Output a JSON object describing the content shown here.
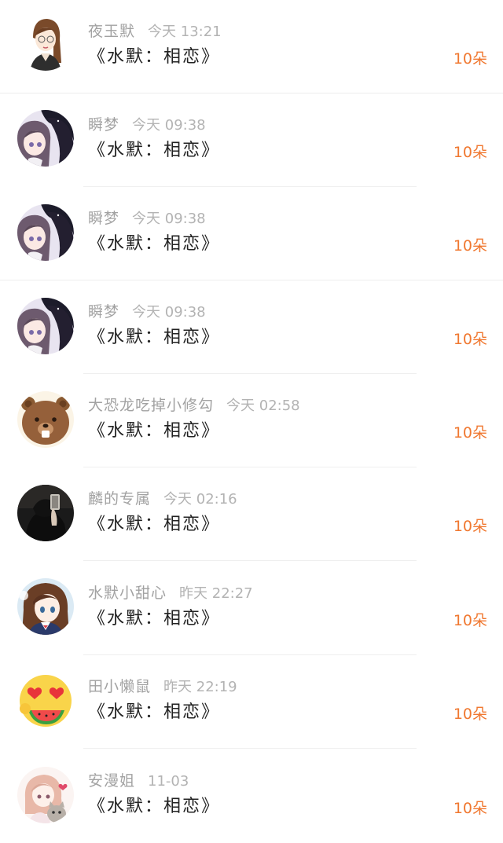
{
  "rows": [
    {
      "name": "夜玉默",
      "time": "今天 13:21",
      "book": "《水默：相恋》",
      "count": "10朵",
      "avatar": "girl-sketch"
    },
    {
      "name": "瞬梦",
      "time": "今天 09:38",
      "book": "《水默：相恋》",
      "count": "10朵",
      "avatar": "anime-couple"
    },
    {
      "name": "瞬梦",
      "time": "今天 09:38",
      "book": "《水默：相恋》",
      "count": "10朵",
      "avatar": "anime-couple"
    },
    {
      "name": "瞬梦",
      "time": "今天 09:38",
      "book": "《水默：相恋》",
      "count": "10朵",
      "avatar": "anime-couple"
    },
    {
      "name": "大恐龙吃掉小修勾",
      "time": "今天 02:58",
      "book": "《水默：相恋》",
      "count": "10朵",
      "avatar": "brown-bear"
    },
    {
      "name": "麟的专属",
      "time": "今天 02:16",
      "book": "《水默：相恋》",
      "count": "10朵",
      "avatar": "dark-selfie"
    },
    {
      "name": "水默小甜心",
      "time": "昨天 22:27",
      "book": "《水默：相恋》",
      "count": "10朵",
      "avatar": "anime-schoolgirl"
    },
    {
      "name": "田小懒鼠",
      "time": "昨天 22:19",
      "book": "《水默：相恋》",
      "count": "10朵",
      "avatar": "heart-eyes-emoji"
    },
    {
      "name": "安漫姐",
      "time": "11-03",
      "book": "《水默：相恋》",
      "count": "10朵",
      "avatar": "anime-girl-cat"
    }
  ],
  "colors": {
    "count": "#f07830",
    "name": "#a2a2a2",
    "time": "#b3b3b3",
    "book": "#222222"
  }
}
